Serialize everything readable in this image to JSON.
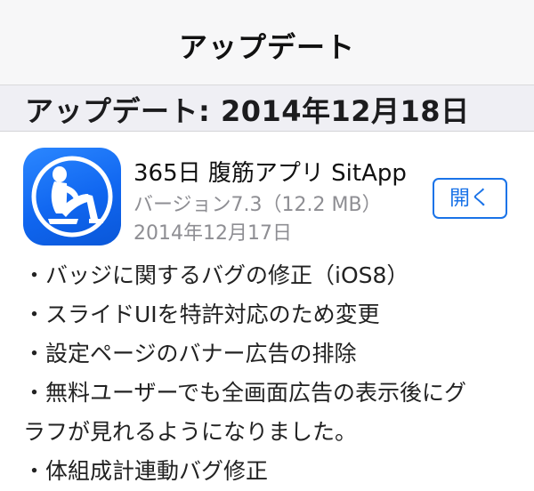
{
  "navbar": {
    "title": "アップデート"
  },
  "section": {
    "title": "アップデート: 2014年12月18日"
  },
  "app": {
    "name": "365日 腹筋アプリ SitApp",
    "version": "バージョン7.3（12.2 MB）",
    "date": "2014年12月17日",
    "open_label": "開く",
    "icon_name": "situp-figure-icon",
    "icon_color": "#1a6ff2"
  },
  "colors": {
    "accent": "#1a73e8",
    "secondary_text": "#8e8e93",
    "section_bg": "#efeff4"
  },
  "notes": [
    "・バッジに関するバグの修正（iOS8）",
    "・スライドUIを特許対応のため変更",
    "・設定ページのバナー広告の排除",
    "・無料ユーザーでも全画面広告の表示後にグ",
    "ラフが見れるようになりました。",
    "・体組成計連動バグ修正"
  ]
}
